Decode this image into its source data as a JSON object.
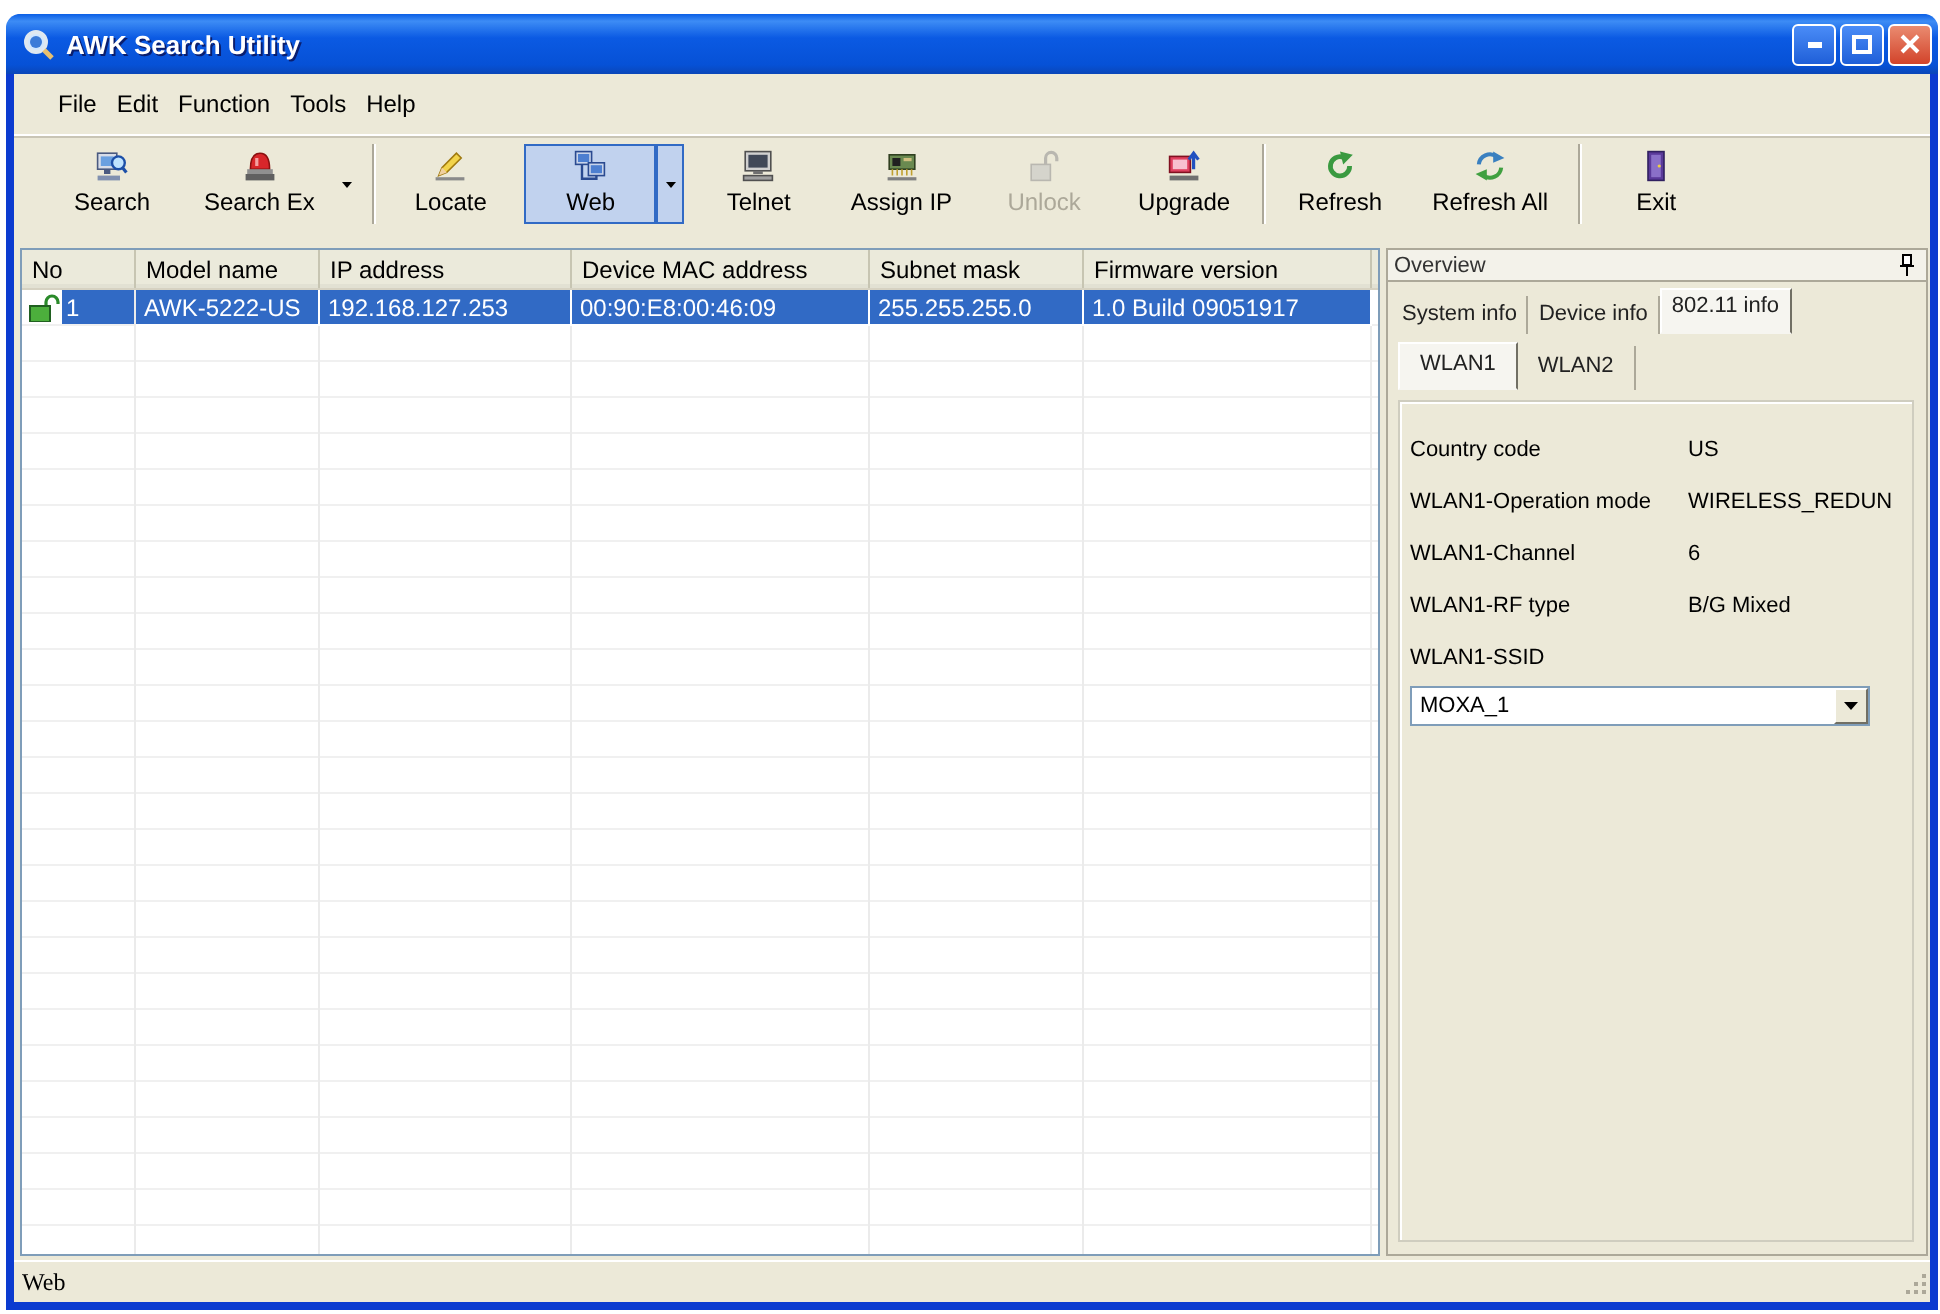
{
  "window": {
    "title": "AWK Search Utility"
  },
  "menu": [
    "File",
    "Edit",
    "Function",
    "Tools",
    "Help"
  ],
  "toolbar": {
    "groups": [
      {
        "buttons": [
          {
            "label": "Search",
            "pressed": false,
            "disabled": false,
            "dropdown": false
          },
          {
            "label": "Search Ex",
            "pressed": false,
            "disabled": false,
            "dropdown": true
          }
        ]
      },
      {
        "buttons": [
          {
            "label": "Locate",
            "pressed": false,
            "disabled": false,
            "dropdown": false
          },
          {
            "label": "Web",
            "pressed": true,
            "disabled": false,
            "dropdown": true
          },
          {
            "label": "Telnet",
            "pressed": false,
            "disabled": false,
            "dropdown": false
          },
          {
            "label": "Assign IP",
            "pressed": false,
            "disabled": false,
            "dropdown": false
          },
          {
            "label": "Unlock",
            "pressed": false,
            "disabled": true,
            "dropdown": false
          },
          {
            "label": "Upgrade",
            "pressed": false,
            "disabled": false,
            "dropdown": false
          }
        ]
      },
      {
        "buttons": [
          {
            "label": "Refresh",
            "pressed": false,
            "disabled": false,
            "dropdown": false
          },
          {
            "label": "Refresh All",
            "pressed": false,
            "disabled": false,
            "dropdown": false
          }
        ]
      },
      {
        "buttons": [
          {
            "label": "Exit",
            "pressed": false,
            "disabled": false,
            "dropdown": false
          }
        ]
      }
    ]
  },
  "table": {
    "columns": [
      "No",
      "Model name",
      "IP address",
      "Device MAC address",
      "Subnet mask",
      "Firmware version"
    ],
    "rows": [
      {
        "selected": true,
        "locked": false,
        "cells": [
          "1",
          "AWK-5222-US",
          "192.168.127.253",
          "00:90:E8:00:46:09",
          "255.255.255.0",
          "1.0 Build 09051917"
        ]
      }
    ]
  },
  "overview": {
    "title": "Overview",
    "tabs": [
      {
        "label": "System info",
        "selected": false
      },
      {
        "label": "Device info",
        "selected": false
      },
      {
        "label": "802.11 info",
        "selected": true
      }
    ],
    "subtabs": [
      {
        "label": "WLAN1",
        "selected": true
      },
      {
        "label": "WLAN2",
        "selected": false
      }
    ],
    "fields": [
      {
        "label": "Country code",
        "value": "US"
      },
      {
        "label": "WLAN1-Operation mode",
        "value": "WIRELESS_REDUN"
      },
      {
        "label": "WLAN1-Channel",
        "value": "6"
      },
      {
        "label": "WLAN1-RF type",
        "value": "B/G Mixed"
      }
    ],
    "ssid": {
      "label": "WLAN1-SSID",
      "value": "MOXA_1"
    }
  },
  "status_bar": {
    "text": "Web"
  }
}
